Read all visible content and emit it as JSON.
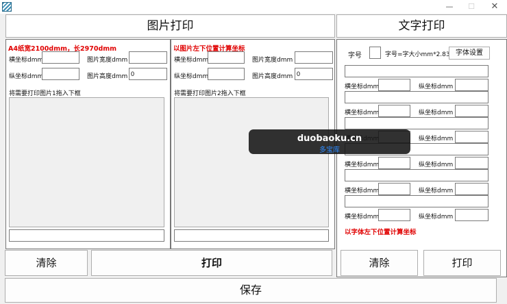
{
  "window": {
    "minimize_icon": "—",
    "maximize_icon": "☐",
    "close_icon": "✕"
  },
  "left": {
    "title": "图片打印",
    "img1": {
      "note": "A4纸宽2100dmm，长2970dmm",
      "x_label": "横坐标dmm",
      "y_label": "纵坐标dmm",
      "w_label": "图片宽度dmm",
      "h_label": "图片高度dmm",
      "x_value": "",
      "y_value": "",
      "w_value": "",
      "h_value": "0",
      "drop_label": "将需要打印图片1拖入下框",
      "path_value": ""
    },
    "img2": {
      "note": "以图片左下位置计算坐标",
      "x_label": "横坐标dmm",
      "y_label": "纵坐标dmm",
      "w_label": "图片宽度dmm",
      "h_label": "图片高度dmm",
      "x_value": "",
      "y_value": "",
      "w_value": "",
      "h_value": "0",
      "drop_label": "将需要打印图片2拖入下框",
      "path_value": ""
    },
    "clear_label": "清除",
    "print_label": "打印"
  },
  "right": {
    "title": "文字打印",
    "size_label": "字号",
    "size_value": "",
    "size_formula": "字号=字大小mm*2.835",
    "font_button": "字体设置",
    "x_label": "横坐标dmm",
    "y_label": "纵坐标dmm",
    "rows": [
      {
        "text": "",
        "x": "",
        "y": ""
      },
      {
        "text": "",
        "x": "",
        "y": ""
      },
      {
        "text": "",
        "x": "",
        "y": ""
      },
      {
        "text": "",
        "x": "",
        "y": ""
      },
      {
        "text": "",
        "x": "",
        "y": ""
      },
      {
        "text": "",
        "x": "",
        "y": ""
      }
    ],
    "note": "以字体左下位置计算坐标",
    "clear_label": "清除",
    "print_label": "打印"
  },
  "save_label": "保存",
  "watermark": {
    "domain": "duobaoku.cn",
    "name": "多宝库"
  }
}
